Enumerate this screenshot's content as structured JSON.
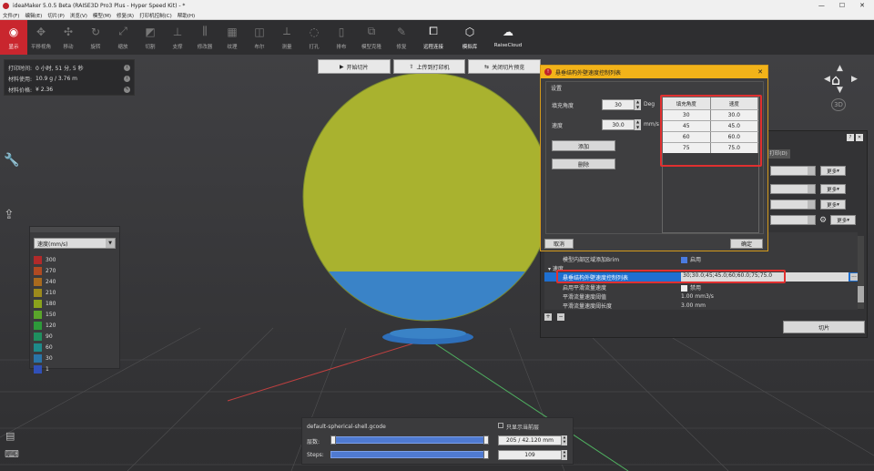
{
  "window": {
    "title": "ideaMaker 5.0.5 Beta (RAISE3D Pro3 Plus - Hyper Speed Kit) - *",
    "minimize": "—",
    "maximize": "☐",
    "close": "✕"
  },
  "menu": [
    "文件(F)",
    "编辑(E)",
    "切片(P)",
    "浏览(V)",
    "模型(M)",
    "修复(R)",
    "打印机控制(C)",
    "帮助(H)"
  ],
  "toolbar": [
    {
      "label": "显示",
      "icon": "eye-icon"
    },
    {
      "label": "平移视角",
      "icon": "pan-icon"
    },
    {
      "label": "移动",
      "icon": "move-icon"
    },
    {
      "label": "旋转",
      "icon": "rotate-icon"
    },
    {
      "label": "缩放",
      "icon": "scale-icon"
    },
    {
      "label": "切割",
      "icon": "cut-icon"
    },
    {
      "label": "支撑",
      "icon": "support-icon"
    },
    {
      "label": "修改器",
      "icon": "modifier-icon"
    },
    {
      "label": "纹理",
      "icon": "texture-icon"
    },
    {
      "label": "布尔",
      "icon": "boolean-icon"
    },
    {
      "label": "测量",
      "icon": "measure-icon"
    },
    {
      "label": "打孔",
      "icon": "hole-icon"
    },
    {
      "label": "排布",
      "icon": "arrange-icon"
    },
    {
      "label": "模型克隆",
      "icon": "clone-icon"
    },
    {
      "label": "修复",
      "icon": "repair-icon"
    },
    {
      "label": "远程连接",
      "icon": "remote-icon"
    },
    {
      "label": "模拟库",
      "icon": "library-icon"
    },
    {
      "label": "RaiseCloud",
      "icon": "cloud-icon"
    }
  ],
  "info": {
    "print_time_label": "打印时间:",
    "print_time": "0 小时, 51 分, 5 秒",
    "material_label": "材料使用:",
    "material": "10.9 g / 3.76 m",
    "cost_label": "材料价格:",
    "cost": "¥ 2.36"
  },
  "actions": {
    "start_slice": "开始切片",
    "upload": "上传到打印机",
    "close": "关闭切片预览"
  },
  "legend": {
    "mode": "速度(mm/s)",
    "items": [
      {
        "value": "300",
        "color": "#b12a2a"
      },
      {
        "value": "270",
        "color": "#b04a22"
      },
      {
        "value": "240",
        "color": "#a86a1e"
      },
      {
        "value": "210",
        "color": "#9c8a1c"
      },
      {
        "value": "180",
        "color": "#8aa21c"
      },
      {
        "value": "150",
        "color": "#5aa52a"
      },
      {
        "value": "120",
        "color": "#2d9a3a"
      },
      {
        "value": "90",
        "color": "#1f8f5f"
      },
      {
        "value": "60",
        "color": "#1e8a8a"
      },
      {
        "value": "30",
        "color": "#2a74a8"
      },
      {
        "value": "1",
        "color": "#3050b8"
      }
    ]
  },
  "dialog": {
    "title": "悬垂结构外壁速度控制列表",
    "group": "设置",
    "angle_label": "填充角度",
    "angle_value": "30",
    "angle_unit": "Deg",
    "speed_label": "速度",
    "speed_value": "30.0",
    "speed_unit": "mm/s",
    "add": "添加",
    "delete": "删除",
    "cancel": "取消",
    "ok": "确定",
    "table_headers": [
      "填充角度",
      "速度"
    ],
    "rows": [
      [
        "30",
        "30.0"
      ],
      [
        "45",
        "45.0"
      ],
      [
        "60",
        "60.0"
      ],
      [
        "75",
        "75.0"
      ]
    ]
  },
  "panel": {
    "tab": "打印(D)",
    "more": "更多",
    "slice_button": "切片",
    "props": [
      {
        "key": "模型内部区域添加Brim",
        "value": "启用"
      },
      {
        "key": "速度",
        "value": ""
      },
      {
        "key": "悬垂结构外壁速度控制列表",
        "value": "30;30.0;45;45.0;60;60.0;75;75.0"
      },
      {
        "key": "启用平滑流量速度",
        "value": "禁用"
      },
      {
        "key": "平滑流量速度阈值",
        "value": "1.00 mm3/s"
      },
      {
        "key": "平滑流量速度阈长度",
        "value": "3.00 mm"
      }
    ],
    "props_more": "..."
  },
  "gcode": {
    "filename": "default-spherical-shell.gcode",
    "only_current": "只显示当前层",
    "layer_label": "层数:",
    "layer_value": "205 / 42.120 mm",
    "steps_label": "Steps:",
    "steps_value": "109"
  }
}
